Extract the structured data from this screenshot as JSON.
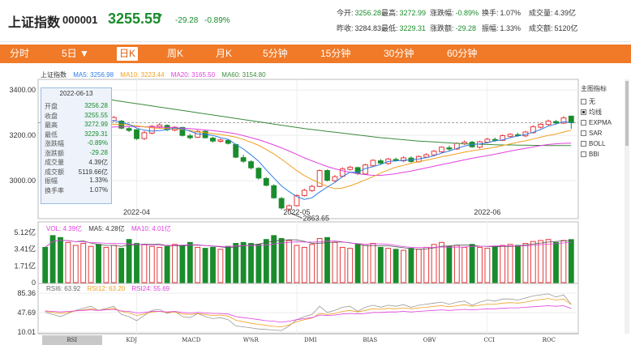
{
  "header": {
    "name": "上证指数",
    "code": "000001",
    "price": "3255.55",
    "arrow": "▼",
    "change": "-29.28",
    "change_pct": "-0.89%",
    "stats": [
      {
        "label": "今开:",
        "value": "3256.28",
        "color": "g"
      },
      {
        "label": "最高:",
        "value": "3272.99",
        "color": "g"
      },
      {
        "label": "涨跌幅:",
        "value": "-0.89%",
        "color": "g"
      },
      {
        "label": "换手:",
        "value": "1.07%",
        "color": "k"
      },
      {
        "label": "成交量:",
        "value": "4.39亿",
        "color": "k"
      },
      {
        "label": "昨收:",
        "value": "3284.83",
        "color": "k"
      },
      {
        "label": "最低:",
        "value": "3229.31",
        "color": "g"
      },
      {
        "label": "涨跌额:",
        "value": "-29.28",
        "color": "g"
      },
      {
        "label": "振幅:",
        "value": "1.33%",
        "color": "k"
      },
      {
        "label": "成交额:",
        "value": "5120亿",
        "color": "k"
      }
    ]
  },
  "tabs": [
    "分时",
    "5日 ▼",
    "日K",
    "周K",
    "月K",
    "5分钟",
    "15分钟",
    "30分钟",
    "60分钟"
  ],
  "active_tab": "日K",
  "legend_main": {
    "name": "上证指数",
    "ma5": "MA5: 3256.98",
    "ma10": "MA10: 3223.44",
    "ma20": "MA20: 3165.50",
    "ma60": "MA60: 3154.80"
  },
  "legend_vol": {
    "vol": "VOL: 4.39亿",
    "ma5": "MA5: 4.28亿",
    "ma10": "MA10: 4.01亿"
  },
  "legend_rsi": {
    "rsi6": "RSI6: 63.92",
    "rsi12": "RSI12: 63.20",
    "rsi24": "RSI24: 55.69"
  },
  "y_main": [
    "3400.00",
    "3200.00",
    "3000.00"
  ],
  "y_vol": [
    "5.12亿",
    "3.41亿",
    "1.71亿",
    "0"
  ],
  "y_rsi": [
    "85.36",
    "47.69",
    "10.01"
  ],
  "x_dates": [
    "2022-04",
    "2022-05",
    "2022-06"
  ],
  "low_annotation": "2863.65",
  "sidebar": {
    "title": "主图指标",
    "items": [
      "无",
      "均线",
      "EXPMA",
      "SAR",
      "BOLL",
      "BBI"
    ],
    "checked": "均线"
  },
  "info_box": {
    "date": "2022-06-13",
    "rows": [
      {
        "label": "开盘",
        "value": "3256.28",
        "color": "g"
      },
      {
        "label": "收盘",
        "value": "3255.55",
        "color": "g"
      },
      {
        "label": "最高",
        "value": "3272.99",
        "color": "g"
      },
      {
        "label": "最低",
        "value": "3229.31",
        "color": "g"
      },
      {
        "label": "涨跌幅",
        "value": "-0.89%",
        "color": "g"
      },
      {
        "label": "涨跌额",
        "value": "-29.28",
        "color": "g"
      },
      {
        "label": "成交量",
        "value": "4.39亿",
        "color": "k"
      },
      {
        "label": "成交额",
        "value": "5119.66亿",
        "color": "k"
      },
      {
        "label": "振幅",
        "value": "1.33%",
        "color": "k"
      },
      {
        "label": "换手率",
        "value": "1.07%",
        "color": "k"
      }
    ]
  },
  "bottom_tabs": [
    "RSI",
    "KDJ",
    "MACD",
    "W%R",
    "DMI",
    "BIAS",
    "OBV",
    "CCI",
    "ROC"
  ],
  "active_bottom_tab": "RSI",
  "colors": {
    "up": "#e4393c",
    "down": "#1a8c2c",
    "ma5": "#2e7de6",
    "ma10": "#f0a020",
    "ma20": "#e040e0",
    "ma60": "#3a8a3a",
    "tabbar": "#f07a28"
  },
  "chart_data": {
    "type": "candlestick",
    "candles": [
      [
        3259,
        3252,
        3275,
        3245
      ],
      [
        3248,
        3223,
        3255,
        3218
      ],
      [
        3220,
        3212,
        3230,
        3205
      ],
      [
        3212,
        3229,
        3235,
        3205
      ],
      [
        3225,
        3251,
        3256,
        3220
      ],
      [
        3248,
        3262,
        3270,
        3242
      ],
      [
        3261,
        3280,
        3285,
        3255
      ],
      [
        3278,
        3258,
        3282,
        3252
      ],
      [
        3256,
        3266,
        3273,
        3250
      ],
      [
        3265,
        3279,
        3286,
        3259
      ],
      [
        3263,
        3232,
        3268,
        3227
      ],
      [
        3230,
        3222,
        3238,
        3215
      ],
      [
        3225,
        3186,
        3228,
        3180
      ],
      [
        3186,
        3212,
        3220,
        3180
      ],
      [
        3210,
        3240,
        3246,
        3205
      ],
      [
        3238,
        3246,
        3255,
        3230
      ],
      [
        3244,
        3225,
        3249,
        3219
      ],
      [
        3223,
        3236,
        3240,
        3218
      ],
      [
        3235,
        3200,
        3238,
        3195
      ],
      [
        3198,
        3190,
        3207,
        3183
      ],
      [
        3192,
        3218,
        3224,
        3188
      ],
      [
        3218,
        3190,
        3222,
        3186
      ],
      [
        3188,
        3175,
        3194,
        3169
      ],
      [
        3174,
        3180,
        3186,
        3168
      ],
      [
        3178,
        3165,
        3183,
        3160
      ],
      [
        3160,
        3104,
        3163,
        3100
      ],
      [
        3102,
        3086,
        3115,
        3079
      ],
      [
        3084,
        3057,
        3090,
        3050
      ],
      [
        3055,
        3012,
        3060,
        3005
      ],
      [
        3010,
        2980,
        3016,
        2975
      ],
      [
        2978,
        2925,
        2985,
        2920
      ],
      [
        2922,
        2880,
        2928,
        2873
      ],
      [
        2875,
        2890,
        2895,
        2864
      ],
      [
        2890,
        2935,
        2940,
        2886
      ],
      [
        2935,
        2958,
        2965,
        2930
      ],
      [
        2957,
        2975,
        2982,
        2950
      ],
      [
        2975,
        3045,
        3050,
        2972
      ],
      [
        3045,
        3002,
        3050,
        2997
      ],
      [
        3000,
        3018,
        3025,
        2995
      ],
      [
        3020,
        3052,
        3060,
        3015
      ],
      [
        3050,
        3060,
        3066,
        3045
      ],
      [
        3058,
        3032,
        3062,
        3025
      ],
      [
        3030,
        3070,
        3075,
        3028
      ],
      [
        3066,
        3090,
        3095,
        3060
      ],
      [
        3088,
        3078,
        3096,
        3072
      ],
      [
        3076,
        3096,
        3101,
        3070
      ],
      [
        3094,
        3090,
        3102,
        3085
      ],
      [
        3088,
        3101,
        3108,
        3082
      ],
      [
        3100,
        3085,
        3108,
        3080
      ],
      [
        3084,
        3107,
        3112,
        3080
      ],
      [
        3104,
        3115,
        3122,
        3100
      ],
      [
        3114,
        3130,
        3136,
        3108
      ],
      [
        3128,
        3148,
        3152,
        3122
      ],
      [
        3145,
        3140,
        3155,
        3132
      ],
      [
        3140,
        3165,
        3170,
        3136
      ],
      [
        3163,
        3170,
        3178,
        3158
      ],
      [
        3170,
        3150,
        3176,
        3145
      ],
      [
        3148,
        3172,
        3176,
        3142
      ],
      [
        3170,
        3183,
        3190,
        3165
      ],
      [
        3182,
        3179,
        3190,
        3172
      ],
      [
        3178,
        3199,
        3205,
        3175
      ],
      [
        3196,
        3205,
        3210,
        3190
      ],
      [
        3203,
        3199,
        3212,
        3194
      ],
      [
        3198,
        3215,
        3220,
        3192
      ],
      [
        3212,
        3238,
        3245,
        3208
      ],
      [
        3236,
        3249,
        3255,
        3230
      ],
      [
        3248,
        3263,
        3270,
        3240
      ],
      [
        3261,
        3255,
        3268,
        3248
      ],
      [
        3254,
        3277,
        3285,
        3250
      ],
      [
        3285,
        3256,
        3273,
        3229
      ]
    ],
    "ma5": [
      3244,
      3240,
      3233,
      3230,
      3227,
      3230,
      3242,
      3255,
      3263,
      3266,
      3257,
      3249,
      3232,
      3223,
      3219,
      3221,
      3225,
      3233,
      3229,
      3219,
      3206,
      3205,
      3200,
      3190,
      3183,
      3160,
      3140,
      3114,
      3086,
      3048,
      3012,
      2977,
      2952,
      2930,
      2918,
      2925,
      2950,
      2972,
      2993,
      3018,
      3038,
      3038,
      3054,
      3062,
      3072,
      3085,
      3088,
      3090,
      3092,
      3096,
      3102,
      3110,
      3122,
      3131,
      3143,
      3153,
      3160,
      3162,
      3168,
      3176,
      3180,
      3190,
      3198,
      3204,
      3214,
      3226,
      3241,
      3250,
      3260,
      3257
    ],
    "ma10": [
      3250,
      3246,
      3241,
      3238,
      3236,
      3236,
      3238,
      3242,
      3246,
      3249,
      3248,
      3246,
      3242,
      3238,
      3234,
      3231,
      3230,
      3229,
      3226,
      3222,
      3215,
      3212,
      3208,
      3204,
      3199,
      3192,
      3182,
      3170,
      3156,
      3138,
      3118,
      3095,
      3070,
      3045,
      3023,
      3005,
      2990,
      2975,
      2965,
      2968,
      2978,
      2990,
      3004,
      3018,
      3034,
      3048,
      3060,
      3068,
      3077,
      3084,
      3091,
      3098,
      3106,
      3112,
      3119,
      3126,
      3132,
      3137,
      3142,
      3148,
      3155,
      3162,
      3170,
      3176,
      3184,
      3192,
      3200,
      3206,
      3215,
      3223
    ],
    "ma20": [
      3230,
      3229,
      3228,
      3227,
      3226,
      3226,
      3228,
      3231,
      3234,
      3237,
      3238,
      3239,
      3239,
      3238,
      3237,
      3236,
      3235,
      3234,
      3232,
      3230,
      3227,
      3224,
      3221,
      3217,
      3213,
      3207,
      3199,
      3190,
      3181,
      3170,
      3158,
      3145,
      3131,
      3116,
      3101,
      3088,
      3075,
      3063,
      3053,
      3044,
      3037,
      3031,
      3027,
      3024,
      3024,
      3027,
      3031,
      3037,
      3043,
      3050,
      3057,
      3064,
      3071,
      3078,
      3085,
      3092,
      3099,
      3105,
      3111,
      3117,
      3124,
      3131,
      3137,
      3143,
      3149,
      3155,
      3160,
      3163,
      3165,
      3166
    ],
    "ma60": [
      3395,
      3391,
      3386,
      3382,
      3378,
      3374,
      3370,
      3365,
      3360,
      3355,
      3350,
      3345,
      3340,
      3335,
      3330,
      3325,
      3320,
      3315,
      3310,
      3305,
      3300,
      3295,
      3290,
      3285,
      3280,
      3275,
      3270,
      3265,
      3260,
      3255,
      3250,
      3245,
      3240,
      3235,
      3230,
      3226,
      3222,
      3218,
      3214,
      3210,
      3206,
      3202,
      3198,
      3194,
      3190,
      3187,
      3184,
      3181,
      3178,
      3175,
      3173,
      3171,
      3169,
      3167,
      3165,
      3163,
      3162,
      3161,
      3160,
      3159,
      3158,
      3158,
      3157,
      3157,
      3156,
      3156,
      3155,
      3155,
      3155,
      3155
    ],
    "volume": [
      3.6,
      4.8,
      4.6,
      4.1,
      3.8,
      4.0,
      3.7,
      3.9,
      3.6,
      3.8,
      3.5,
      4.4,
      4.0,
      3.9,
      3.7,
      3.6,
      3.7,
      3.9,
      3.8,
      4.1,
      3.6,
      3.5,
      3.6,
      3.4,
      3.7,
      4.0,
      4.1,
      4.0,
      3.9,
      4.4,
      4.8,
      4.5,
      4.3,
      3.8,
      3.6,
      3.9,
      4.5,
      4.6,
      4.1,
      3.6,
      3.5,
      3.9,
      3.8,
      4.0,
      3.6,
      3.5,
      3.4,
      3.3,
      3.5,
      3.4,
      3.6,
      3.9,
      4.1,
      3.7,
      3.8,
      3.6,
      3.9,
      3.6,
      3.5,
      3.7,
      3.8,
      3.9,
      3.8,
      4.0,
      4.2,
      4.3,
      4.4,
      4.1,
      4.3,
      4.39
    ],
    "rsi6": [
      48,
      44,
      40,
      46,
      52,
      56,
      60,
      52,
      56,
      60,
      44,
      40,
      32,
      42,
      52,
      54,
      46,
      50,
      40,
      38,
      46,
      40,
      36,
      38,
      34,
      22,
      20,
      18,
      16,
      15,
      14,
      13,
      22,
      34,
      40,
      44,
      60,
      48,
      52,
      58,
      60,
      50,
      58,
      62,
      58,
      62,
      60,
      63,
      58,
      62,
      64,
      66,
      68,
      64,
      68,
      70,
      62,
      68,
      72,
      70,
      74,
      74,
      72,
      76,
      80,
      82,
      84,
      78,
      82,
      63.92
    ],
    "rsi12": [
      50,
      48,
      46,
      48,
      51,
      53,
      55,
      52,
      54,
      56,
      50,
      47,
      42,
      45,
      49,
      50,
      48,
      49,
      45,
      44,
      46,
      44,
      42,
      43,
      41,
      33,
      30,
      27,
      25,
      23,
      21,
      20,
      24,
      30,
      34,
      37,
      46,
      44,
      46,
      50,
      52,
      49,
      52,
      55,
      54,
      56,
      55,
      57,
      55,
      57,
      58,
      60,
      61,
      59,
      61,
      63,
      60,
      62,
      64,
      64,
      66,
      67,
      66,
      68,
      71,
      73,
      75,
      72,
      74,
      63.2
    ],
    "rsi24": [
      51,
      50,
      49,
      50,
      51,
      52,
      53,
      52,
      53,
      54,
      51,
      50,
      47,
      48,
      50,
      50,
      49,
      50,
      48,
      47,
      48,
      47,
      46,
      46,
      45,
      40,
      38,
      36,
      34,
      32,
      31,
      29,
      31,
      34,
      36,
      38,
      43,
      42,
      43,
      45,
      46,
      45,
      46,
      48,
      48,
      49,
      49,
      50,
      49,
      50,
      51,
      52,
      53,
      52,
      53,
      54,
      53,
      54,
      55,
      55,
      56,
      57,
      57,
      58,
      59,
      60,
      61,
      60,
      61,
      55.69
    ],
    "ylim_main": [
      2840,
      3440
    ],
    "ylim_vol": [
      0,
      5.12
    ],
    "ylim_rsi": [
      10.01,
      85.36
    ]
  }
}
